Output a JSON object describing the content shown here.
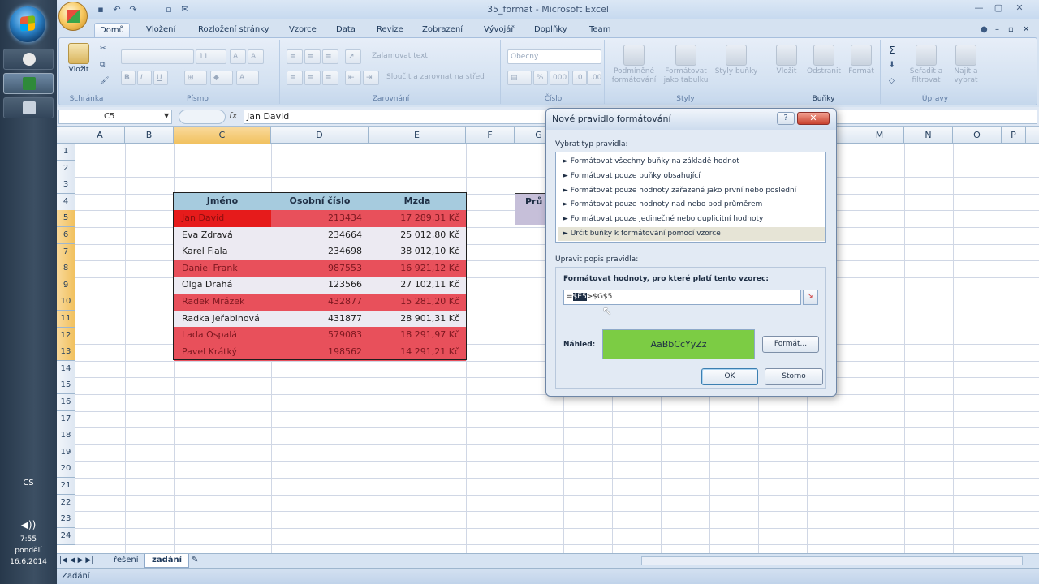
{
  "window": {
    "title": "35_format - Microsoft Excel"
  },
  "taskbar": {
    "tray_cs": "CS",
    "time": "7:55",
    "day": "pondělí",
    "date": "16.6.2014"
  },
  "ribbon": {
    "tabs": [
      "Domů",
      "Vložení",
      "Rozložení stránky",
      "Vzorce",
      "Data",
      "Revize",
      "Zobrazení",
      "Vývojář",
      "Doplňky",
      "Team"
    ],
    "selected_tab": "Domů",
    "clipboard": {
      "paste": "Vložit",
      "label": "Schránka"
    },
    "font": {
      "font_name": "",
      "font_size": "11",
      "label": "Písmo",
      "bold": "B",
      "italic": "I",
      "underline": "U"
    },
    "alignment": {
      "wrap": "Zalamovat text",
      "merge": "Sloučit a zarovnat na střed",
      "label": "Zarovnání"
    },
    "number": {
      "format": "Obecný",
      "label": "Číslo",
      "percent": "%",
      "thousands": "000"
    },
    "styles": {
      "conditional": "Podmíněné formátování",
      "as_table": "Formátovat jako tabulku",
      "cell_styles": "Styly buňky",
      "label": "Styly"
    },
    "cells": {
      "insert": "Vložit",
      "delete": "Odstranit",
      "format": "Formát",
      "label": "Buňky"
    },
    "editing": {
      "sort": "Seřadit a filtrovat",
      "find": "Najít a vybrat",
      "label": "Úpravy"
    }
  },
  "formula_bar": {
    "name_box": "C5",
    "fx": "fx",
    "content": "Jan David"
  },
  "columns": [
    "A",
    "B",
    "C",
    "D",
    "E",
    "F",
    "G",
    "H",
    "I",
    "J",
    "K",
    "L",
    "M",
    "N",
    "O",
    "P"
  ],
  "rows": [
    "1",
    "2",
    "3",
    "4",
    "5",
    "6",
    "7",
    "8",
    "9",
    "10",
    "11",
    "12",
    "13",
    "14",
    "15",
    "16",
    "17",
    "18",
    "19",
    "20",
    "21",
    "22",
    "23",
    "24"
  ],
  "table": {
    "headers": [
      "Jméno",
      "Osobní číslo",
      "Mzda"
    ],
    "rows": [
      {
        "name": "Jan David",
        "id": "213434",
        "salary": "17 289,31 Kč",
        "style": "red"
      },
      {
        "name": "Eva Zdravá",
        "id": "234664",
        "salary": "25 012,80 Kč",
        "style": "grey"
      },
      {
        "name": "Karel Fiala",
        "id": "234698",
        "salary": "38 012,10 Kč",
        "style": "grey"
      },
      {
        "name": "Daniel Frank",
        "id": "987553",
        "salary": "16 921,12 Kč",
        "style": "red"
      },
      {
        "name": "Olga Drahá",
        "id": "123566",
        "salary": "27 102,11 Kč",
        "style": "grey"
      },
      {
        "name": "Radek Mrázek",
        "id": "432877",
        "salary": "15 281,20 Kč",
        "style": "red"
      },
      {
        "name": "Radka Jeřabinová",
        "id": "431877",
        "salary": "28 901,31 Kč",
        "style": "grey"
      },
      {
        "name": "Lada Ospalá",
        "id": "579083",
        "salary": "18 291,97 Kč",
        "style": "red"
      },
      {
        "name": "Pavel Krátký",
        "id": "198562",
        "salary": "14 291,21 Kč",
        "style": "red"
      }
    ]
  },
  "side_cell": "Prů",
  "sheets": {
    "tabs": [
      "řešení",
      "zadání"
    ],
    "selected": "zadání"
  },
  "status": "Zadání",
  "dialog": {
    "title": "Nové pravidlo formátování",
    "help": "?",
    "close": "✕",
    "select_type_label": "Vybrat typ pravidla:",
    "rule_types": [
      "► Formátovat všechny buňky na základě hodnot",
      "► Formátovat pouze buňky obsahující",
      "► Formátovat pouze hodnoty zařazené jako první nebo poslední",
      "► Formátovat pouze hodnoty nad nebo pod průměrem",
      "► Formátovat pouze jedinečné nebo duplicitní hodnoty",
      "► Určit buňky k formátování pomocí vzorce"
    ],
    "selected_rule": 5,
    "edit_label": "Upravit popis pravidla:",
    "formula_label": "Formátovat hodnoty, pro které platí tento vzorec:",
    "formula_prefix": "=",
    "formula_selected": "$E5",
    "formula_suffix": ">$G$5",
    "preview_label": "Náhled:",
    "preview_text": "AaBbCcYyZz",
    "format_button": "Formát...",
    "ok": "OK",
    "cancel": "Storno"
  }
}
